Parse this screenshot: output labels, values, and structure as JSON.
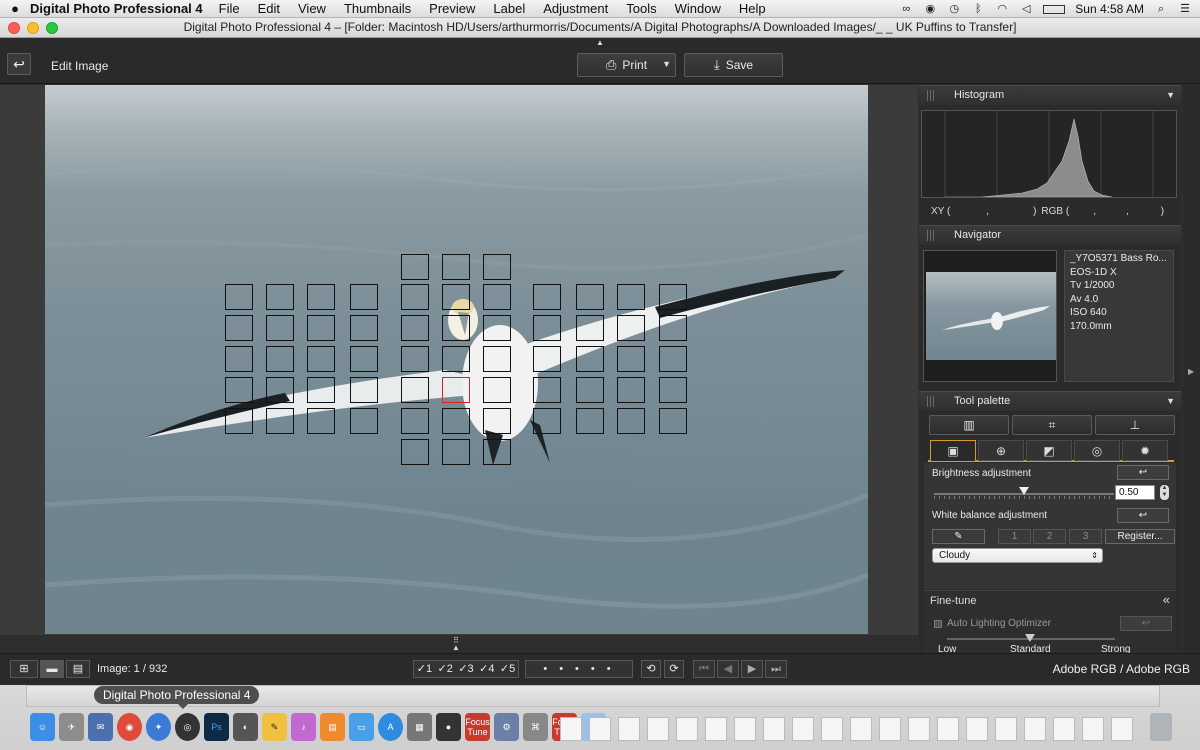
{
  "menubar": {
    "app_name": "Digital Photo Professional 4",
    "menus": [
      "File",
      "Edit",
      "View",
      "Thumbnails",
      "Preview",
      "Label",
      "Adjustment",
      "Tools",
      "Window",
      "Help"
    ],
    "clock": "Sun 4:58 AM"
  },
  "window": {
    "title": "Digital Photo Professional 4 – [Folder: Macintosh HD/Users/arthurmorris/Documents/A Digital Photographs/A Downloaded Images/_ _ UK Puffins to Transfer]"
  },
  "toolbar": {
    "mode_label": "Edit Image",
    "print_label": "Print",
    "save_label": "Save"
  },
  "histogram": {
    "title": "Histogram",
    "xy_label": "XY (",
    "xy_sep1": ",",
    "xy_close": ")",
    "rgb_label": "RGB (",
    "rgb_sep1": ",",
    "rgb_sep2": ",",
    "rgb_close": ")"
  },
  "navigator": {
    "title": "Navigator",
    "meta": {
      "filename": "_Y7O5371  Bass Ro...",
      "camera": "EOS-1D X",
      "shutter": "Tv 1/2000",
      "aperture": "Av 4.0",
      "iso": "ISO 640",
      "focal": "170.0mm"
    }
  },
  "tool_palette": {
    "title": "Tool palette",
    "brightness_label": "Brightness adjustment",
    "brightness_value": "0.50",
    "brightness_level": 0.5,
    "wb_label": "White balance adjustment",
    "wb_buttons": [
      "1",
      "2",
      "3"
    ],
    "register_label": "Register...",
    "wb_selected": "Cloudy",
    "finetune_label": "Fine-tune",
    "alo_label": "Auto Lighting Optimizer",
    "alo_levels": [
      "Low",
      "Standard",
      "Strong"
    ]
  },
  "bottombar": {
    "image_count": "Image: 1 / 932",
    "ratings": [
      "1",
      "2",
      "3",
      "4",
      "5"
    ],
    "color_space": "Adobe RGB / Adobe RGB"
  },
  "dock": {
    "tooltip": "Digital Photo Professional 4",
    "focus_label": "Focus",
    "tune_label": "Tune"
  },
  "colors": {
    "accent": "#d99a2a",
    "af_selected": "#dd2222",
    "panel_bg": "#2b2b2b"
  }
}
